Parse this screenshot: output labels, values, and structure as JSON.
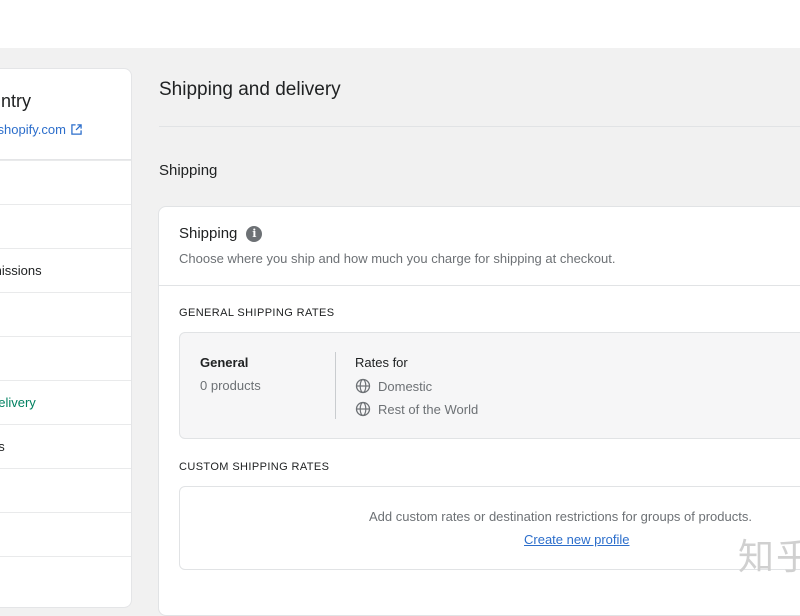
{
  "sidebar": {
    "store_name": "untry",
    "store_url": "yshopify.com",
    "items": [
      {
        "label": ""
      },
      {
        "label": ""
      },
      {
        "label": "missions"
      },
      {
        "label": ""
      },
      {
        "label": ""
      },
      {
        "label": "delivery"
      },
      {
        "label": "es"
      },
      {
        "label": ""
      },
      {
        "label": ""
      },
      {
        "label": ""
      }
    ]
  },
  "main": {
    "title": "Shipping and delivery",
    "section_title": "Shipping",
    "card": {
      "title": "Shipping",
      "info_glyph": "i",
      "description": "Choose where you ship and how much you charge for shipping at checkout.",
      "general_heading": "GENERAL SHIPPING RATES",
      "general_profile": {
        "name": "General",
        "count": "0 products",
        "rates_for_label": "Rates for",
        "zones": [
          "Domestic",
          "Rest of the World"
        ]
      },
      "custom_heading": "CUSTOM SHIPPING RATES",
      "custom_text": "Add custom rates or destination restrictions for groups of products.",
      "create_link": "Create new profile"
    }
  },
  "watermark": "知乎",
  "colors": {
    "accent_link": "#2c6ecb",
    "active_nav": "#008060",
    "muted_text": "#6d7175"
  },
  "icons": [
    "external-link-icon",
    "info-icon",
    "globe-icon"
  ]
}
